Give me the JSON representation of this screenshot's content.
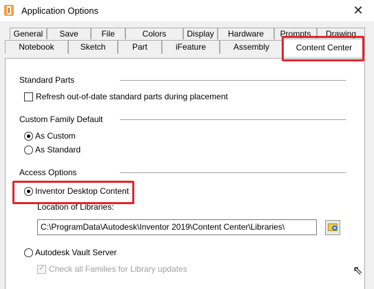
{
  "window": {
    "title": "Application Options",
    "close_glyph": "✕"
  },
  "tabs": {
    "row1": [
      "General",
      "Save",
      "File",
      "Colors",
      "Display",
      "Hardware",
      "Prompts",
      "Drawing"
    ],
    "row2": [
      "Notebook",
      "Sketch",
      "Part",
      "iFeature",
      "Assembly"
    ],
    "active": "Content Center"
  },
  "standard_parts": {
    "title": "Standard Parts",
    "refresh_label": "Refresh out-of-date standard parts during placement",
    "refresh_checked": false
  },
  "custom_family": {
    "title": "Custom Family Default",
    "as_custom_label": "As Custom",
    "as_standard_label": "As Standard",
    "selected": "As Custom"
  },
  "access_options": {
    "title": "Access Options",
    "desktop_label": "Inventor Desktop Content",
    "libraries_label": "Location of Libraries:",
    "libraries_path": "C:\\ProgramData\\Autodesk\\Inventor 2019\\Content Center\\Libraries\\",
    "vault_label": "Autodesk Vault Server",
    "check_families_label": "Check all Families for Library updates",
    "selected": "Inventor Desktop Content"
  },
  "icons": {
    "app": "inventor-app-icon",
    "browse": "folder-browse-icon",
    "cursor": "mouse-cursor-icon"
  },
  "colors": {
    "highlight": "#e0262a",
    "panel": "#ffffff",
    "window": "#f0f0f0"
  }
}
